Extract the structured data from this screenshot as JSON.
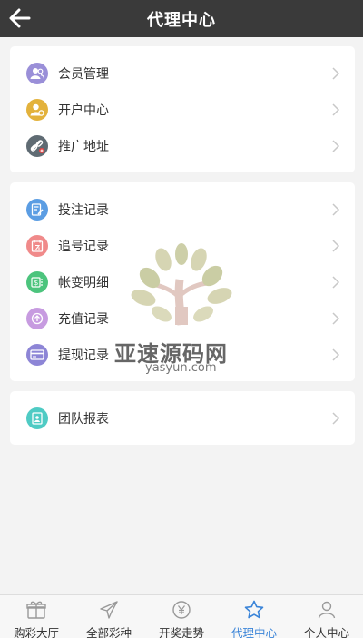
{
  "header": {
    "title": "代理中心",
    "back_icon": "arrow-left-icon"
  },
  "groups": [
    {
      "items": [
        {
          "label": "会员管理",
          "icon": "members-icon",
          "color": "#9a8fd8"
        },
        {
          "label": "开户中心",
          "icon": "user-settings-icon",
          "color": "#e3b23c"
        },
        {
          "label": "推广地址",
          "icon": "link-icon",
          "color": "#5f6b73"
        }
      ]
    },
    {
      "items": [
        {
          "label": "投注记录",
          "icon": "bet-record-icon",
          "color": "#5b9de3"
        },
        {
          "label": "追号记录",
          "icon": "chase-number-icon",
          "color": "#f08a8a"
        },
        {
          "label": "帐变明细",
          "icon": "money-icon",
          "color": "#4cc47d"
        },
        {
          "label": "充值记录",
          "icon": "deposit-icon",
          "color": "#c79be0"
        },
        {
          "label": "提现记录",
          "icon": "card-icon",
          "color": "#8d85d6"
        }
      ]
    },
    {
      "items": [
        {
          "label": "团队报表",
          "icon": "report-icon",
          "color": "#4fcbc4"
        }
      ]
    }
  ],
  "watermark": {
    "text": "亚速源码网",
    "url": "yasyun.com"
  },
  "tabbar": [
    {
      "label": "购彩大厅",
      "icon": "gift-icon",
      "active": false
    },
    {
      "label": "全部彩种",
      "icon": "plane-icon",
      "active": false
    },
    {
      "label": "开奖走势",
      "icon": "coin-icon",
      "active": false
    },
    {
      "label": "代理中心",
      "icon": "star-icon",
      "active": true
    },
    {
      "label": "个人中心",
      "icon": "user-icon",
      "active": false
    }
  ],
  "colors": {
    "header_bg": "#3a3a3a",
    "active_tab": "#3a84d8"
  }
}
